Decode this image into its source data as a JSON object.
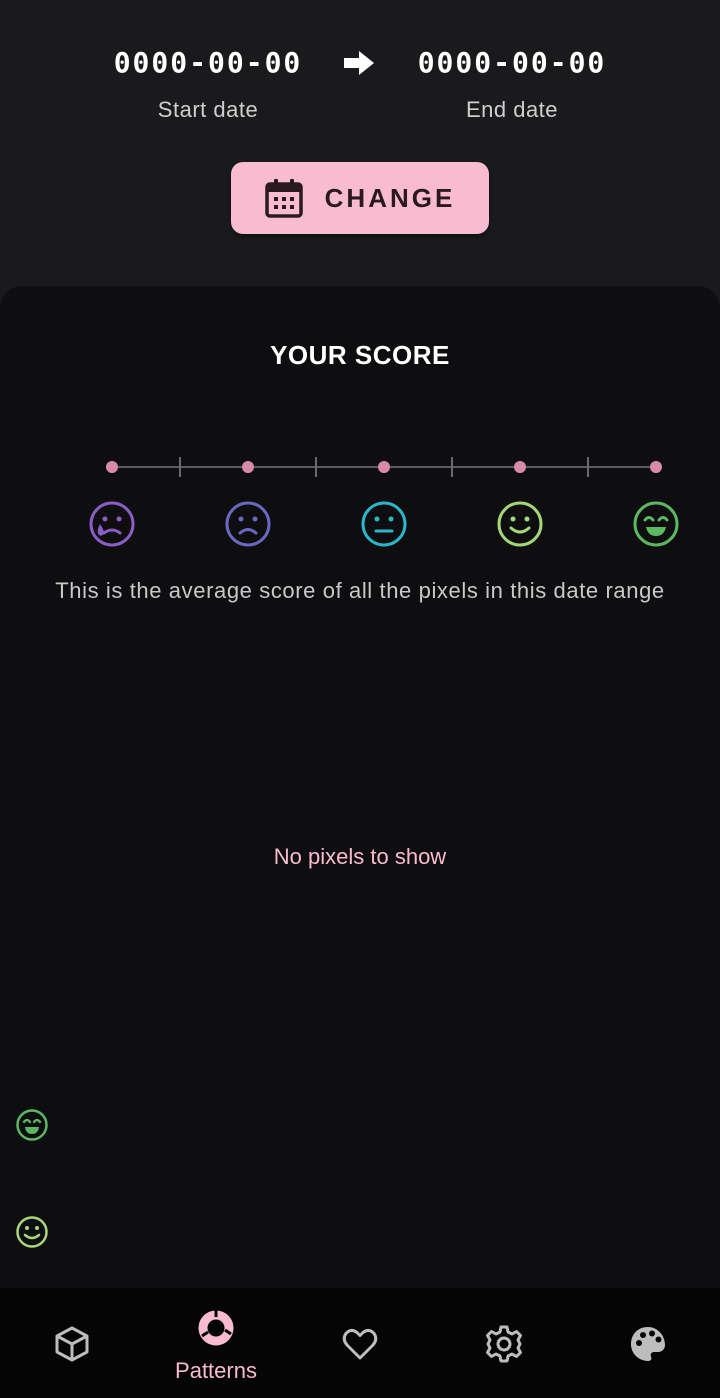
{
  "date_range": {
    "start_value": "0000-00-00",
    "start_label": "Start date",
    "end_value": "0000-00-00",
    "end_label": "End date",
    "change_label": "CHANGE"
  },
  "score": {
    "title": "YOUR SCORE",
    "description": "This is the average score of all the pixels in this date range",
    "moods": [
      {
        "name": "awful",
        "color": "#8e5cc6"
      },
      {
        "name": "bad",
        "color": "#6a68c2"
      },
      {
        "name": "neutral",
        "color": "#2bb7c9"
      },
      {
        "name": "good",
        "color": "#a6d67a"
      },
      {
        "name": "great",
        "color": "#5cb860"
      }
    ]
  },
  "empty_message": "No pixels to show",
  "nav": {
    "items": [
      {
        "icon": "cube-icon"
      },
      {
        "icon": "patterns-icon",
        "label": "Patterns",
        "active": true
      },
      {
        "icon": "heart-icon"
      },
      {
        "icon": "gear-icon"
      },
      {
        "icon": "palette-icon"
      }
    ]
  },
  "colors": {
    "accent": "#f8bbd0",
    "background": "#1a1a1c",
    "card": "#0e0e10",
    "scale_dot": "#d98aa6",
    "nav_icon": "#bdbdbd"
  }
}
